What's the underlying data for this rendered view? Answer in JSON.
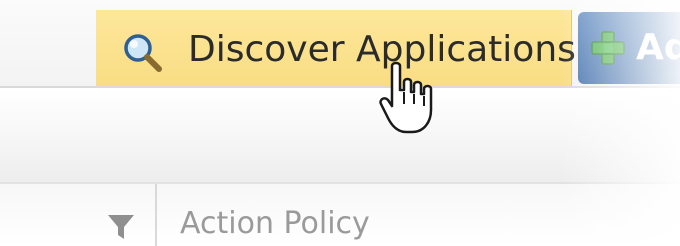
{
  "toolbar": {
    "discover_button": {
      "label": "Discover Applications",
      "icon": "magnifier-icon"
    },
    "add_button": {
      "label": "Ad",
      "icon": "green-plus-icon"
    }
  },
  "grid": {
    "filter_icon": "filter-funnel-icon",
    "column_header": "Action Policy"
  },
  "colors": {
    "discover_highlight": "#f9dd84",
    "add_button_blue": "#4c78b0",
    "plus_green": "#5cb85c"
  }
}
